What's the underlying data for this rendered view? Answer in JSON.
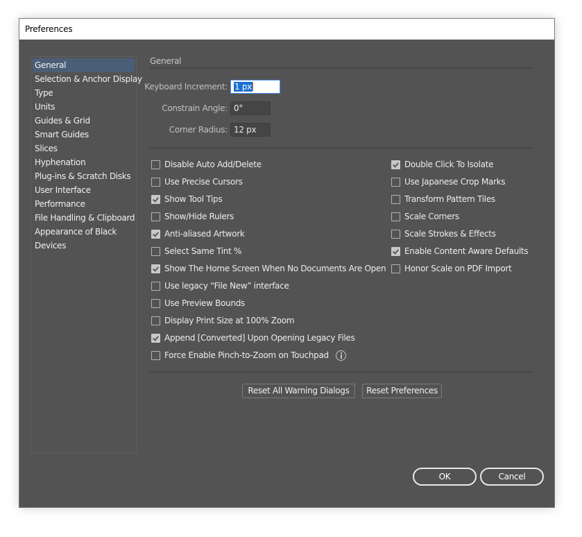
{
  "window": {
    "title": "Preferences"
  },
  "sidebar": {
    "selected_index": 0,
    "items": [
      {
        "label": "General"
      },
      {
        "label": "Selection & Anchor Display"
      },
      {
        "label": "Type"
      },
      {
        "label": "Units"
      },
      {
        "label": "Guides & Grid"
      },
      {
        "label": "Smart Guides"
      },
      {
        "label": "Slices"
      },
      {
        "label": "Hyphenation"
      },
      {
        "label": "Plug-ins & Scratch Disks"
      },
      {
        "label": "User Interface"
      },
      {
        "label": "Performance"
      },
      {
        "label": "File Handling & Clipboard"
      },
      {
        "label": "Appearance of Black"
      },
      {
        "label": "Devices"
      }
    ]
  },
  "panel": {
    "section_title": "General",
    "fields": {
      "keyboard_increment": {
        "label": "Keyboard Increment:",
        "value": "1 px"
      },
      "constrain_angle": {
        "label": "Constrain Angle:",
        "value": "0°"
      },
      "corner_radius": {
        "label": "Corner Radius:",
        "value": "12 px"
      }
    },
    "left_options": [
      {
        "label": "Disable Auto Add/Delete",
        "checked": false
      },
      {
        "label": "Use Precise Cursors",
        "checked": false
      },
      {
        "label": "Show Tool Tips",
        "checked": true
      },
      {
        "label": "Show/Hide Rulers",
        "checked": false
      },
      {
        "label": "Anti-aliased Artwork",
        "checked": true
      },
      {
        "label": "Select Same Tint %",
        "checked": false
      },
      {
        "label": "Show The Home Screen When No Documents Are Open",
        "checked": true
      },
      {
        "label": "Use legacy “File New” interface",
        "checked": false
      },
      {
        "label": "Use Preview Bounds",
        "checked": false
      },
      {
        "label": "Display Print Size at 100% Zoom",
        "checked": false
      },
      {
        "label": "Append [Converted] Upon Opening Legacy Files",
        "checked": true
      },
      {
        "label": "Force Enable Pinch-to-Zoom on Touchpad",
        "checked": false,
        "info_icon": "info-icon"
      }
    ],
    "right_options": [
      {
        "label": "Double Click To Isolate",
        "checked": true
      },
      {
        "label": "Use Japanese Crop Marks",
        "checked": false
      },
      {
        "label": "Transform Pattern Tiles",
        "checked": false
      },
      {
        "label": "Scale Corners",
        "checked": false
      },
      {
        "label": "Scale Strokes & Effects",
        "checked": false
      },
      {
        "label": "Enable Content Aware Defaults",
        "checked": true
      },
      {
        "label": "Honor Scale on PDF Import",
        "checked": false
      }
    ],
    "buttons": {
      "reset_warnings": "Reset All Warning Dialogs",
      "reset_preferences": "Reset Preferences"
    }
  },
  "footer": {
    "ok_label": "OK",
    "cancel_label": "Cancel"
  },
  "colors": {
    "dialog_bg": "#535353",
    "selection_bg": "#4b5e77",
    "text_selection": "#1a6fd1",
    "focus_border": "#4d90fe"
  }
}
